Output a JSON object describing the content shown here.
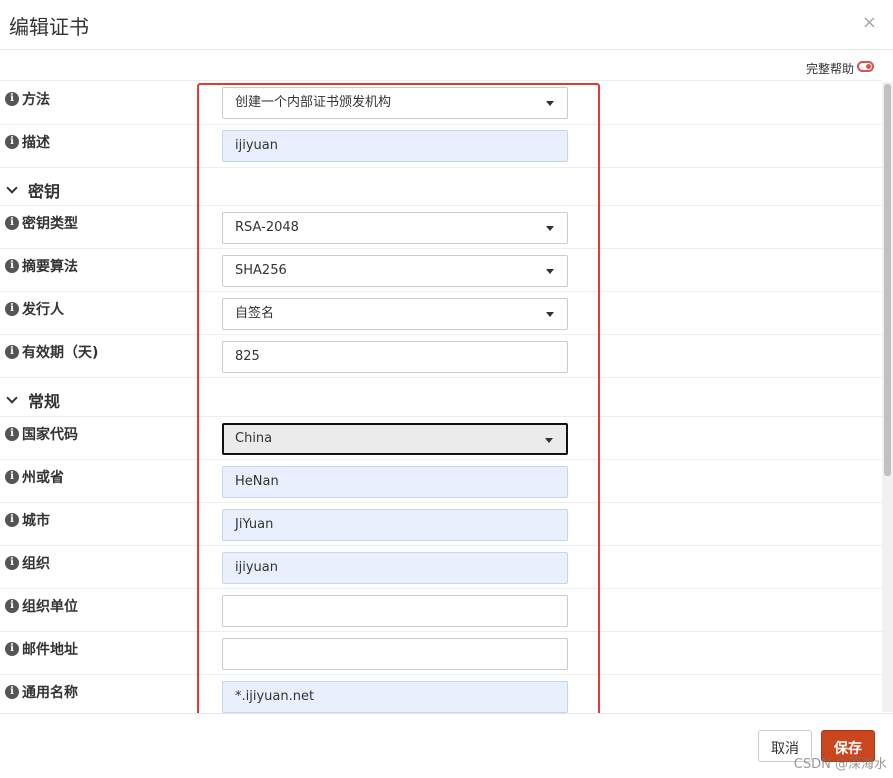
{
  "dialog": {
    "title": "编辑证书",
    "close_glyph": "×",
    "help_label": "完整帮助"
  },
  "info_glyph": "i",
  "fields": {
    "method": {
      "label": "方法",
      "value": "创建一个内部证书颁发机构"
    },
    "description": {
      "label": "描述",
      "value": "ijiyuan"
    },
    "key_type": {
      "label": "密钥类型",
      "value": "RSA-2048"
    },
    "digest": {
      "label": "摘要算法",
      "value": "SHA256"
    },
    "issuer": {
      "label": "发行人",
      "value": "自签名"
    },
    "lifetime": {
      "label": "有效期（天)",
      "value": "825"
    },
    "country": {
      "label": "国家代码",
      "value": "China"
    },
    "state": {
      "label": "州或省",
      "value": "HeNan"
    },
    "city": {
      "label": "城市",
      "value": "JiYuan"
    },
    "org": {
      "label": "组织",
      "value": "ijiyuan"
    },
    "org_unit": {
      "label": "组织单位",
      "value": ""
    },
    "email": {
      "label": "邮件地址",
      "value": ""
    },
    "common_name": {
      "label": "通用名称",
      "value": "*.ijiyuan.net"
    }
  },
  "sections": {
    "key": "密钥",
    "general": "常规"
  },
  "footer": {
    "cancel_label": "取消",
    "save_label": "保存",
    "watermark": "CSDN @深海水"
  },
  "colors": {
    "save_button": "#c9461f",
    "highlight_border": "#e53935",
    "filled_field": "#e8f0fe"
  }
}
